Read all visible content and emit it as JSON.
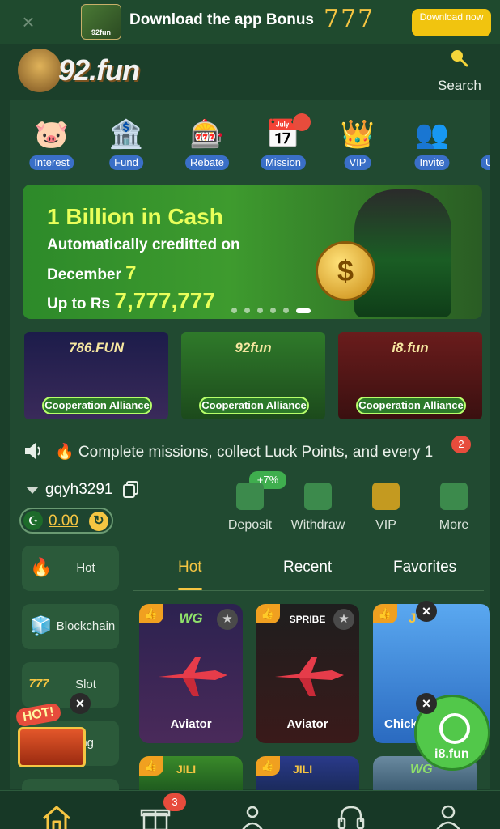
{
  "download_bar": {
    "close": "×",
    "thumb_label": "92fun",
    "title": "Download the app Bonus",
    "bonus": "777",
    "button": "Download now"
  },
  "header": {
    "logo": "92.fun",
    "search_label": "Search"
  },
  "quick_menu": [
    {
      "label": "Interest",
      "icon": "piggy-bank-icon",
      "glyph": "🐷"
    },
    {
      "label": "Fund",
      "icon": "fund-house-icon",
      "glyph": "🏦"
    },
    {
      "label": "Rebate",
      "icon": "rebate-chips-icon",
      "glyph": "🎰"
    },
    {
      "label": "Mission",
      "icon": "mission-calendar-icon",
      "glyph": "📅"
    },
    {
      "label": "VIP",
      "icon": "crown-icon",
      "glyph": "👑"
    },
    {
      "label": "Invite",
      "icon": "invite-people-icon",
      "glyph": "👥"
    },
    {
      "label": "U",
      "icon": "more-icon",
      "glyph": ""
    }
  ],
  "banner": {
    "line1": "1 Billion in Cash",
    "line2": "Automatically creditted on",
    "line3_prefix": "December",
    "line3_day": "7",
    "line4_prefix": "Up to Rs",
    "line4_amount": "7,777,777",
    "coin": "$",
    "slides": 6,
    "active_slide": 6
  },
  "cooperation": [
    {
      "brand": "786.FUN",
      "label": "Cooperation Alliance"
    },
    {
      "brand": "92fun",
      "label": "Cooperation Alliance"
    },
    {
      "brand": "i8.fun",
      "label": "Cooperation Alliance"
    }
  ],
  "notice": {
    "text": "🔥 Complete missions, collect Luck Points, and every 1",
    "badge": "2"
  },
  "user": {
    "name": "gqyh3291",
    "currency_icon": "☪",
    "balance": "0.00",
    "refresh": "↻"
  },
  "actions": [
    {
      "label": "Deposit",
      "icon": "wallet-icon"
    },
    {
      "label": "Withdraw",
      "icon": "withdraw-icon"
    },
    {
      "label": "VIP",
      "icon": "vip-badge-icon"
    },
    {
      "label": "More",
      "icon": "more-grid-icon"
    }
  ],
  "deposit_bonus": "+7%",
  "sidebar": [
    {
      "label": "Hot",
      "icon": "fire-icon",
      "glyph": "🔥"
    },
    {
      "label": "Blockchain",
      "icon": "blockchain-cubes-icon",
      "glyph": "🧊"
    },
    {
      "label": "Slot",
      "icon": "slot-777-icon",
      "glyph": "777"
    },
    {
      "label": "ing",
      "icon": "",
      "glyph": ""
    }
  ],
  "tabs": [
    "Hot",
    "Recent",
    "Favorites"
  ],
  "games": [
    {
      "brand": "WG",
      "name": "Aviator",
      "bg": "#3a2a52"
    },
    {
      "brand": "SPRIBE",
      "name": "Aviator",
      "bg": "#2b2b2b"
    },
    {
      "brand": "J",
      "name": "Chick",
      "bg": "#3c7fd0"
    }
  ],
  "games_row2": [
    {
      "brand": "JILI"
    },
    {
      "brand": "JILI"
    },
    {
      "brand": "WG"
    }
  ],
  "hot_chest": {
    "label": "HOT!",
    "close": "×"
  },
  "whatsapp": {
    "label": "i8.fun",
    "close": "×"
  },
  "bottom_nav": {
    "gift_badge": "3"
  },
  "colors": {
    "background": "#1b3f2a",
    "panel": "#214a31",
    "accent": "#f5c542",
    "badge": "#e74c3c"
  }
}
